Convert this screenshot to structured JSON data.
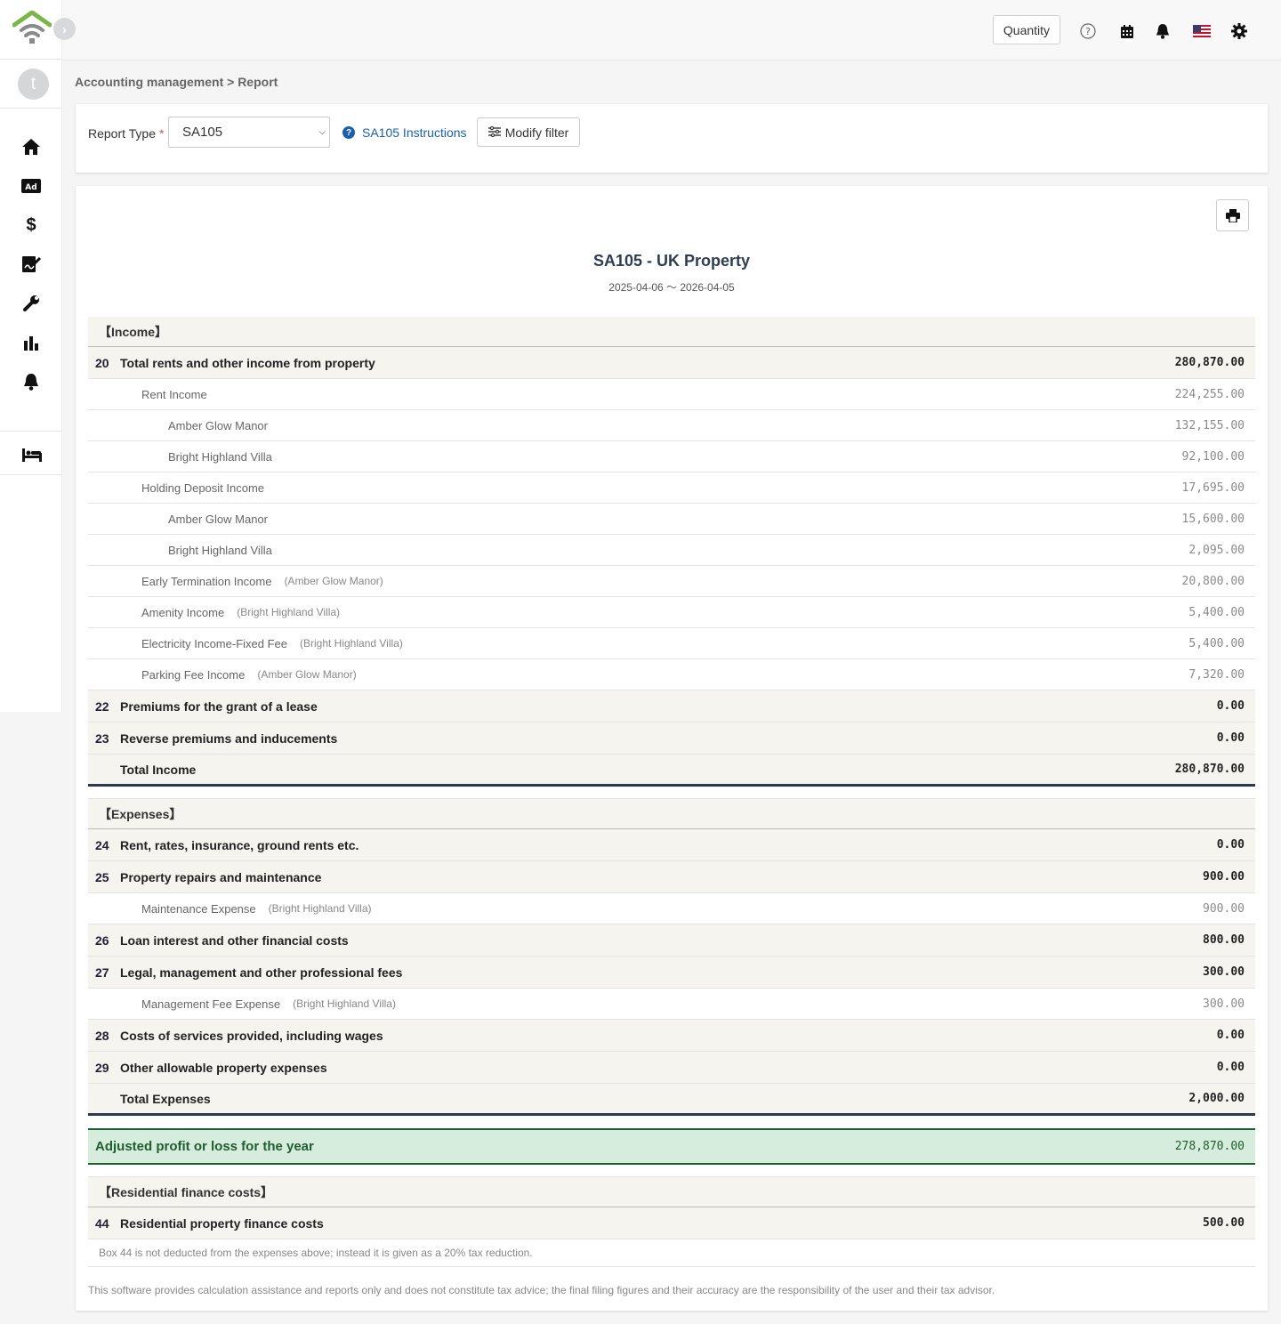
{
  "sidebar": {
    "avatar_letter": "t",
    "nav": [
      "home-icon",
      "ad-icon",
      "dollar-icon",
      "signature-icon",
      "wrench-icon",
      "bar-chart-icon",
      "bell-icon",
      "bed-icon"
    ]
  },
  "topbar": {
    "quantity_label": "Quantity",
    "icons": [
      "help-circle-icon",
      "calendar-icon",
      "bell-icon",
      "us-flag-icon",
      "gear-icon"
    ]
  },
  "breadcrumb": "Accounting management > Report",
  "filter": {
    "report_type_label": "Report Type",
    "required_mark": "*",
    "report_type_value": "SA105",
    "instructions_label": "SA105 Instructions",
    "modify_label": "Modify filter"
  },
  "report": {
    "title": "SA105 - UK Property",
    "range": "2025-04-06 〜 2026-04-05",
    "income_header": "【Income】",
    "box20": {
      "num": "20",
      "label": "Total rents and other income from property",
      "amount": "280,870.00"
    },
    "rent_income": {
      "label": "Rent Income",
      "amount": "224,255.00"
    },
    "rent_amber": {
      "label": "Amber Glow Manor",
      "amount": "132,155.00"
    },
    "rent_bright": {
      "label": "Bright Highland Villa",
      "amount": "92,100.00"
    },
    "holding_income": {
      "label": "Holding Deposit Income",
      "amount": "17,695.00"
    },
    "holding_amber": {
      "label": "Amber Glow Manor",
      "amount": "15,600.00"
    },
    "holding_bright": {
      "label": "Bright Highland Villa",
      "amount": "2,095.00"
    },
    "early_term": {
      "label": "Early Termination Income",
      "prop": "(Amber Glow Manor)",
      "amount": "20,800.00"
    },
    "amenity": {
      "label": "Amenity Income",
      "prop": "(Bright Highland Villa)",
      "amount": "5,400.00"
    },
    "electricity": {
      "label": "Electricity Income-Fixed Fee",
      "prop": "(Bright Highland Villa)",
      "amount": "5,400.00"
    },
    "parking": {
      "label": "Parking Fee Income",
      "prop": "(Amber Glow Manor)",
      "amount": "7,320.00"
    },
    "box22": {
      "num": "22",
      "label": "Premiums for the grant of a lease",
      "amount": "0.00"
    },
    "box23": {
      "num": "23",
      "label": "Reverse premiums and inducements",
      "amount": "0.00"
    },
    "total_income": {
      "label": "Total Income",
      "amount": "280,870.00"
    },
    "expenses_header": "【Expenses】",
    "box24": {
      "num": "24",
      "label": "Rent, rates, insurance, ground rents etc.",
      "amount": "0.00"
    },
    "box25": {
      "num": "25",
      "label": "Property repairs and maintenance",
      "amount": "900.00"
    },
    "maint": {
      "label": "Maintenance Expense",
      "prop": "(Bright Highland Villa)",
      "amount": "900.00"
    },
    "box26": {
      "num": "26",
      "label": "Loan interest and other financial costs",
      "amount": "800.00"
    },
    "box27": {
      "num": "27",
      "label": "Legal, management and other professional fees",
      "amount": "300.00"
    },
    "mgmt": {
      "label": "Management Fee Expense",
      "prop": "(Bright Highland Villa)",
      "amount": "300.00"
    },
    "box28": {
      "num": "28",
      "label": "Costs of services provided, including wages",
      "amount": "0.00"
    },
    "box29": {
      "num": "29",
      "label": "Other allowable property expenses",
      "amount": "0.00"
    },
    "total_expenses": {
      "label": "Total Expenses",
      "amount": "2,000.00"
    },
    "profit": {
      "label": "Adjusted profit or loss for the year",
      "amount": "278,870.00"
    },
    "finance_header": "【Residential finance costs】",
    "box44": {
      "num": "44",
      "label": "Residential property finance costs",
      "amount": "500.00"
    },
    "box44_note": "Box 44 is not deducted from the expenses above; instead it is given as a 20% tax reduction.",
    "disclaimer": "This software provides calculation assistance and reports only and does not constitute tax advice; the final filing figures and their accuracy are the responsibility of the user and their tax advisor."
  }
}
